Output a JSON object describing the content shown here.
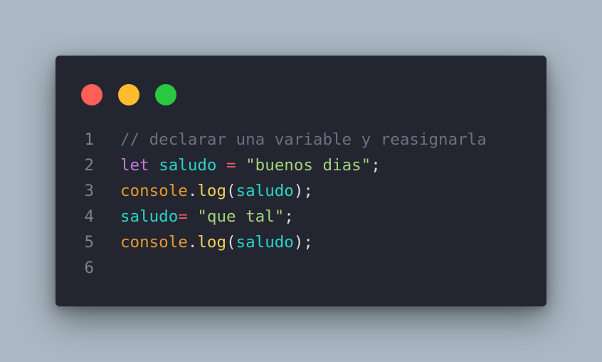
{
  "window": {
    "controls": [
      {
        "name": "close",
        "color": "#ff5f57"
      },
      {
        "name": "minimize",
        "color": "#febc2e"
      },
      {
        "name": "maximize",
        "color": "#28c840"
      }
    ]
  },
  "editor": {
    "lines": [
      {
        "number": "1",
        "tokens": [
          {
            "text": "// declarar una variable y reasignarla",
            "type": "comment"
          }
        ]
      },
      {
        "number": "2",
        "tokens": [
          {
            "text": "let",
            "type": "keyword"
          },
          {
            "text": " ",
            "type": "punct"
          },
          {
            "text": "saludo",
            "type": "var"
          },
          {
            "text": " ",
            "type": "punct"
          },
          {
            "text": "=",
            "type": "op"
          },
          {
            "text": " ",
            "type": "punct"
          },
          {
            "text": "\"buenos dias\"",
            "type": "string"
          },
          {
            "text": ";",
            "type": "punct"
          }
        ]
      },
      {
        "number": "3",
        "tokens": [
          {
            "text": "console",
            "type": "object"
          },
          {
            "text": ".",
            "type": "punct"
          },
          {
            "text": "log",
            "type": "method"
          },
          {
            "text": "(",
            "type": "punct"
          },
          {
            "text": "saludo",
            "type": "var"
          },
          {
            "text": ");",
            "type": "punct"
          }
        ]
      },
      {
        "number": "4",
        "tokens": [
          {
            "text": "saludo",
            "type": "var"
          },
          {
            "text": "=",
            "type": "op"
          },
          {
            "text": " ",
            "type": "punct"
          },
          {
            "text": "\"que tal\"",
            "type": "string"
          },
          {
            "text": ";",
            "type": "punct"
          }
        ]
      },
      {
        "number": "5",
        "tokens": [
          {
            "text": "console",
            "type": "object"
          },
          {
            "text": ".",
            "type": "punct"
          },
          {
            "text": "log",
            "type": "method"
          },
          {
            "text": "(",
            "type": "punct"
          },
          {
            "text": "saludo",
            "type": "var"
          },
          {
            "text": ");",
            "type": "punct"
          }
        ]
      },
      {
        "number": "6",
        "tokens": []
      }
    ]
  }
}
